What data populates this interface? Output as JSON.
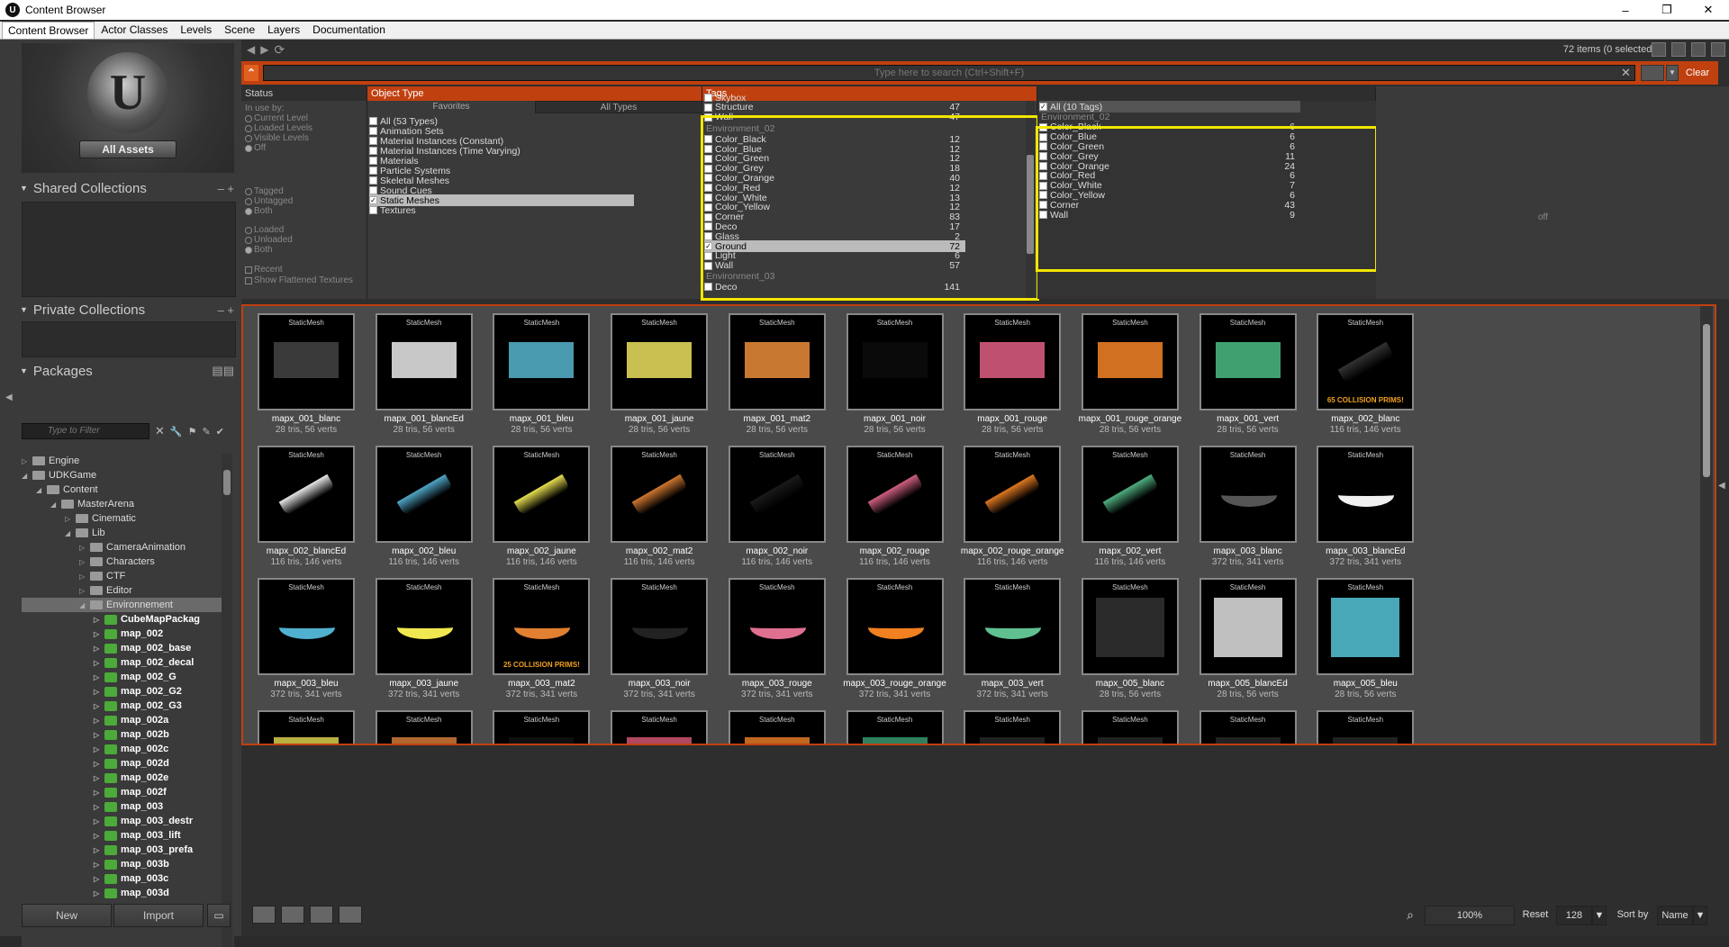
{
  "window": {
    "title": "Content Browser",
    "app_icon": "U",
    "minimize": "–",
    "maximize": "❐",
    "close": "✕"
  },
  "tabs": [
    "Content Browser",
    "Actor Classes",
    "Levels",
    "Scene",
    "Layers",
    "Documentation"
  ],
  "left": {
    "all_assets": "All Assets",
    "shared_collections": "Shared Collections",
    "private_collections": "Private Collections",
    "packages": "Packages",
    "filter_placeholder": "Type to Filter",
    "new_button": "New",
    "import_button": "Import",
    "tree": [
      {
        "label": "Engine",
        "indent": 0,
        "type": "folder",
        "tw": "▷"
      },
      {
        "label": "UDKGame",
        "indent": 0,
        "type": "folder",
        "tw": "◢"
      },
      {
        "label": "Content",
        "indent": 1,
        "type": "folder",
        "tw": "◢"
      },
      {
        "label": "MasterArena",
        "indent": 2,
        "type": "folder",
        "tw": "◢"
      },
      {
        "label": "Cinematic",
        "indent": 3,
        "type": "folder",
        "tw": "▷"
      },
      {
        "label": "Lib",
        "indent": 3,
        "type": "folder",
        "tw": "◢"
      },
      {
        "label": "CameraAnimation",
        "indent": 4,
        "type": "folder",
        "tw": "▷"
      },
      {
        "label": "Characters",
        "indent": 4,
        "type": "folder",
        "tw": "▷"
      },
      {
        "label": "CTF",
        "indent": 4,
        "type": "folder",
        "tw": "▷"
      },
      {
        "label": "Editor",
        "indent": 4,
        "type": "folder",
        "tw": "▷"
      },
      {
        "label": "Environnement",
        "indent": 4,
        "type": "folder",
        "tw": "◢",
        "sel": true
      },
      {
        "label": "CubeMapPackag",
        "indent": 5,
        "type": "pkg",
        "tw": "▷"
      },
      {
        "label": "map_002",
        "indent": 5,
        "type": "pkg",
        "tw": "▷"
      },
      {
        "label": "map_002_base",
        "indent": 5,
        "type": "pkg",
        "tw": "▷"
      },
      {
        "label": "map_002_decal",
        "indent": 5,
        "type": "pkg",
        "tw": "▷"
      },
      {
        "label": "map_002_G",
        "indent": 5,
        "type": "pkg",
        "tw": "▷"
      },
      {
        "label": "map_002_G2",
        "indent": 5,
        "type": "pkg",
        "tw": "▷"
      },
      {
        "label": "map_002_G3",
        "indent": 5,
        "type": "pkg",
        "tw": "▷"
      },
      {
        "label": "map_002a",
        "indent": 5,
        "type": "pkg",
        "tw": "▷"
      },
      {
        "label": "map_002b",
        "indent": 5,
        "type": "pkg",
        "tw": "▷"
      },
      {
        "label": "map_002c",
        "indent": 5,
        "type": "pkg",
        "tw": "▷"
      },
      {
        "label": "map_002d",
        "indent": 5,
        "type": "pkg",
        "tw": "▷"
      },
      {
        "label": "map_002e",
        "indent": 5,
        "type": "pkg",
        "tw": "▷"
      },
      {
        "label": "map_002f",
        "indent": 5,
        "type": "pkg",
        "tw": "▷"
      },
      {
        "label": "map_003",
        "indent": 5,
        "type": "pkg",
        "tw": "▷"
      },
      {
        "label": "map_003_destr",
        "indent": 5,
        "type": "pkg",
        "tw": "▷"
      },
      {
        "label": "map_003_lift",
        "indent": 5,
        "type": "pkg",
        "tw": "▷"
      },
      {
        "label": "map_003_prefa",
        "indent": 5,
        "type": "pkg",
        "tw": "▷"
      },
      {
        "label": "map_003b",
        "indent": 5,
        "type": "pkg",
        "tw": "▷"
      },
      {
        "label": "map_003c",
        "indent": 5,
        "type": "pkg",
        "tw": "▷"
      },
      {
        "label": "map_003d",
        "indent": 5,
        "type": "pkg",
        "tw": "▷"
      }
    ]
  },
  "toolbar": {
    "item_count": "72 items (0 selected)",
    "search_placeholder": "Type here to search  (Ctrl+Shift+F)",
    "clear": "Clear"
  },
  "status": {
    "header": "Status",
    "in_use_by": "In use by:",
    "in_use_options": [
      "Current Level",
      "Loaded Levels",
      "Visible Levels",
      "Off"
    ],
    "tag_options": [
      "Tagged",
      "Untagged",
      "Both"
    ],
    "load_options": [
      "Loaded",
      "Unloaded",
      "Both"
    ],
    "recent": "Recent",
    "show_flattened": "Show Flattened Textures"
  },
  "object_type": {
    "header": "Object Type",
    "tab_favorites": "Favorites",
    "tab_all": "All Types",
    "items": [
      {
        "label": "All (53 Types)",
        "checked": false
      },
      {
        "label": "Animation Sets",
        "checked": false
      },
      {
        "label": "Material Instances (Constant)",
        "checked": false
      },
      {
        "label": "Material Instances (Time Varying)",
        "checked": false
      },
      {
        "label": "Materials",
        "checked": false
      },
      {
        "label": "Particle Systems",
        "checked": false
      },
      {
        "label": "Skeletal Meshes",
        "checked": false
      },
      {
        "label": "Sound Cues",
        "checked": false
      },
      {
        "label": "Static Meshes",
        "checked": true
      },
      {
        "label": "Textures",
        "checked": false
      }
    ]
  },
  "tags": {
    "header": "Tags",
    "top": [
      {
        "label": "Skybox",
        "count": ""
      },
      {
        "label": "Structure",
        "count": "47"
      },
      {
        "label": "Wall",
        "count": "47"
      }
    ],
    "group1": "Environment_02",
    "group1_items": [
      {
        "label": "Color_Black",
        "count": "12"
      },
      {
        "label": "Color_Blue",
        "count": "12"
      },
      {
        "label": "Color_Green",
        "count": "12"
      },
      {
        "label": "Color_Grey",
        "count": "18"
      },
      {
        "label": "Color_Orange",
        "count": "40"
      },
      {
        "label": "Color_Red",
        "count": "12"
      },
      {
        "label": "Color_White",
        "count": "13"
      },
      {
        "label": "Color_Yellow",
        "count": "12"
      },
      {
        "label": "Corner",
        "count": "83"
      },
      {
        "label": "Deco",
        "count": "17"
      },
      {
        "label": "Glass",
        "count": "2"
      },
      {
        "label": "Ground",
        "count": "72",
        "checked": true
      },
      {
        "label": "Light",
        "count": "6"
      },
      {
        "label": "Wall",
        "count": "57"
      }
    ],
    "group2": "Environment_03",
    "group2_items": [
      {
        "label": "Deco",
        "count": "141"
      }
    ]
  },
  "result_tags": {
    "all": "All (10 Tags)",
    "group": "Environment_02",
    "items": [
      {
        "label": "Color_Black",
        "count": "6"
      },
      {
        "label": "Color_Blue",
        "count": "6"
      },
      {
        "label": "Color_Green",
        "count": "6"
      },
      {
        "label": "Color_Grey",
        "count": "11"
      },
      {
        "label": "Color_Orange",
        "count": "24"
      },
      {
        "label": "Color_Red",
        "count": "6"
      },
      {
        "label": "Color_White",
        "count": "7"
      },
      {
        "label": "Color_Yellow",
        "count": "6"
      },
      {
        "label": "Corner",
        "count": "43"
      },
      {
        "label": "Wall",
        "count": "9"
      }
    ],
    "off_label": "off"
  },
  "assets": [
    {
      "name": "mapx_001_blanc",
      "meta": "28 tris, 56 verts",
      "shape": "flat",
      "color": "#3a3a3a"
    },
    {
      "name": "mapx_001_blancEd",
      "meta": "28 tris, 56 verts",
      "shape": "flat",
      "color": "#c8c8c8"
    },
    {
      "name": "mapx_001_bleu",
      "meta": "28 tris, 56 verts",
      "shape": "flat",
      "color": "#4a9ab0"
    },
    {
      "name": "mapx_001_jaune",
      "meta": "28 tris, 56 verts",
      "shape": "flat",
      "color": "#c8c050"
    },
    {
      "name": "mapx_001_mat2",
      "meta": "28 tris, 56 verts",
      "shape": "flat",
      "color": "#c87830"
    },
    {
      "name": "mapx_001_noir",
      "meta": "28 tris, 56 verts",
      "shape": "flat",
      "color": "#0a0a0a"
    },
    {
      "name": "mapx_001_rouge",
      "meta": "28 tris, 56 verts",
      "shape": "flat",
      "color": "#c05070"
    },
    {
      "name": "mapx_001_rouge_orange",
      "meta": "28 tris, 56 verts",
      "shape": "flat",
      "color": "#d07020"
    },
    {
      "name": "mapx_001_vert",
      "meta": "28 tris, 56 verts",
      "shape": "flat",
      "color": "#40a070"
    },
    {
      "name": "mapx_002_blanc",
      "meta": "116 tris, 146 verts",
      "shape": "ramp",
      "color": "#333",
      "prims": "65 COLLISION PRIMS!"
    },
    {
      "name": "mapx_002_blancEd",
      "meta": "116 tris, 146 verts",
      "shape": "ramp",
      "color": "#e8e8e8"
    },
    {
      "name": "mapx_002_bleu",
      "meta": "116 tris, 146 verts",
      "shape": "ramp",
      "color": "#50a8c8"
    },
    {
      "name": "mapx_002_jaune",
      "meta": "116 tris, 146 verts",
      "shape": "ramp",
      "color": "#e8e050"
    },
    {
      "name": "mapx_002_mat2",
      "meta": "116 tris, 146 verts",
      "shape": "ramp",
      "color": "#d07830"
    },
    {
      "name": "mapx_002_noir",
      "meta": "116 tris, 146 verts",
      "shape": "ramp",
      "color": "#1a1a1a"
    },
    {
      "name": "mapx_002_rouge",
      "meta": "116 tris, 146 verts",
      "shape": "ramp",
      "color": "#d06080"
    },
    {
      "name": "mapx_002_rouge_orange",
      "meta": "116 tris, 146 verts",
      "shape": "ramp",
      "color": "#e07820"
    },
    {
      "name": "mapx_002_vert",
      "meta": "116 tris, 146 verts",
      "shape": "ramp",
      "color": "#50b080"
    },
    {
      "name": "mapx_003_blanc",
      "meta": "372 tris, 341 verts",
      "shape": "curve",
      "color": "#555"
    },
    {
      "name": "mapx_003_blancEd",
      "meta": "372 tris, 341 verts",
      "shape": "curve",
      "color": "#f0f0f0"
    },
    {
      "name": "mapx_003_bleu",
      "meta": "372 tris, 341 verts",
      "shape": "curve",
      "color": "#50b0d0"
    },
    {
      "name": "mapx_003_jaune",
      "meta": "372 tris, 341 verts",
      "shape": "curve",
      "color": "#f0e850"
    },
    {
      "name": "mapx_003_mat2",
      "meta": "372 tris, 341 verts",
      "shape": "curve",
      "color": "#e08030",
      "prims": "25 COLLISION PRIMS!"
    },
    {
      "name": "mapx_003_noir",
      "meta": "372 tris, 341 verts",
      "shape": "curve",
      "color": "#222"
    },
    {
      "name": "mapx_003_rouge",
      "meta": "372 tris, 341 verts",
      "shape": "curve",
      "color": "#e07090"
    },
    {
      "name": "mapx_003_rouge_orange",
      "meta": "372 tris, 341 verts",
      "shape": "curve",
      "color": "#f08020"
    },
    {
      "name": "mapx_003_vert",
      "meta": "372 tris, 341 verts",
      "shape": "curve",
      "color": "#60c090"
    },
    {
      "name": "mapx_005_blanc",
      "meta": "28 tris, 56 verts",
      "shape": "square",
      "color": "#2a2a2a"
    },
    {
      "name": "mapx_005_blancEd",
      "meta": "28 tris, 56 verts",
      "shape": "square",
      "color": "#c0c0c0"
    },
    {
      "name": "mapx_005_bleu",
      "meta": "28 tris, 56 verts",
      "shape": "square",
      "color": "#48a8b8"
    },
    {
      "name": "",
      "meta": "",
      "shape": "partial",
      "color": "#b8b040"
    },
    {
      "name": "",
      "meta": "",
      "shape": "partial",
      "color": "#b06830"
    },
    {
      "name": "",
      "meta": "",
      "shape": "partial",
      "color": "#101010"
    },
    {
      "name": "",
      "meta": "",
      "shape": "partial",
      "color": "#b04860"
    },
    {
      "name": "",
      "meta": "",
      "shape": "partial",
      "color": "#c06820"
    },
    {
      "name": "",
      "meta": "",
      "shape": "partial",
      "color": "#308060"
    },
    {
      "name": "",
      "meta": "",
      "shape": "partial",
      "color": "#222"
    },
    {
      "name": "",
      "meta": "",
      "shape": "partial",
      "color": "#222"
    },
    {
      "name": "",
      "meta": "",
      "shape": "partial",
      "color": "#222"
    },
    {
      "name": "",
      "meta": "",
      "shape": "partial",
      "color": "#222"
    }
  ],
  "tile_type_label": "StaticMesh",
  "bottom": {
    "zoom": "100%",
    "reset": "Reset",
    "size": "128",
    "sort_by": "Sort by",
    "sort_value": "Name"
  },
  "colors": {
    "accent": "#c04010",
    "highlight": "#f2e600"
  }
}
